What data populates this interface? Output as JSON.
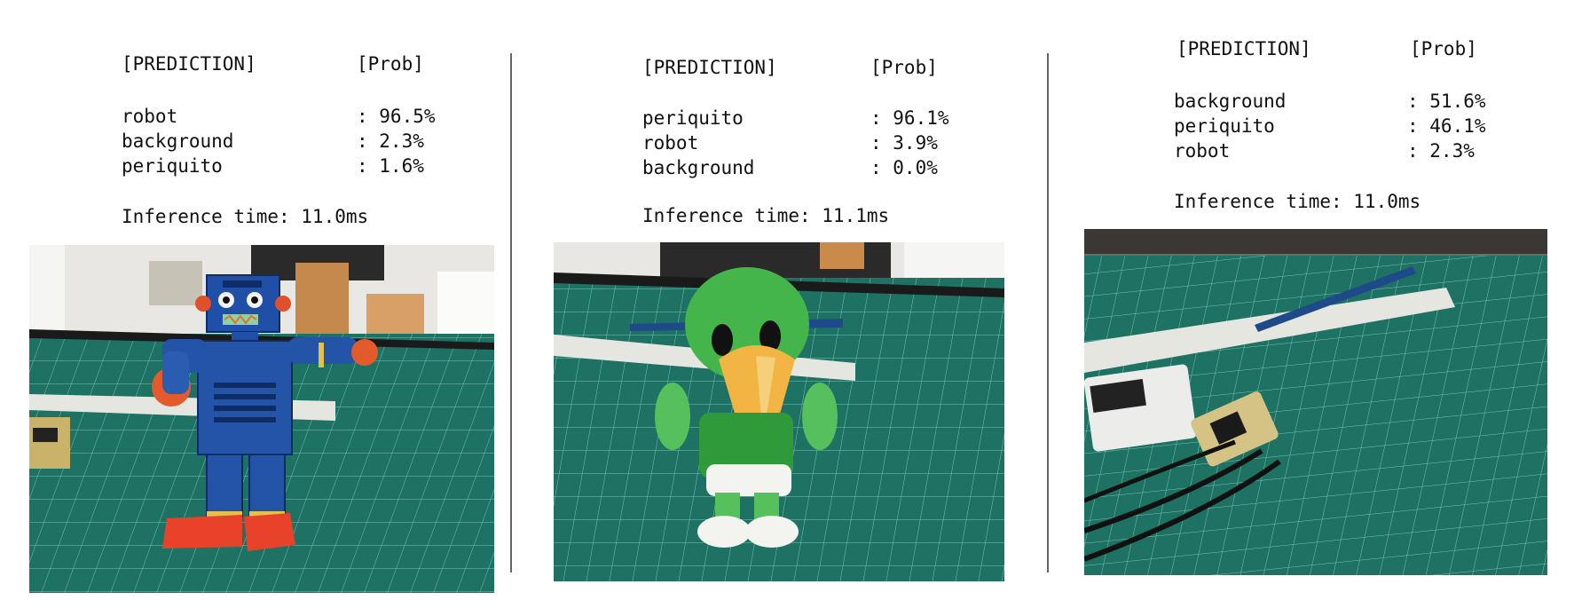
{
  "panels": [
    {
      "header": {
        "prediction": "[PREDICTION]",
        "prob": "[Prob]"
      },
      "rows": [
        {
          "label": "robot",
          "value": ": 96.5%"
        },
        {
          "label": "background",
          "value": ": 2.3%"
        },
        {
          "label": "periquito",
          "value": ": 1.6%"
        }
      ],
      "inference": "Inference time: 11.0ms"
    },
    {
      "header": {
        "prediction": "[PREDICTION]",
        "prob": "[Prob]"
      },
      "rows": [
        {
          "label": "periquito",
          "value": ": 96.1%"
        },
        {
          "label": "robot",
          "value": ": 3.9%"
        },
        {
          "label": "background",
          "value": ": 0.0%"
        }
      ],
      "inference": "Inference time: 11.1ms"
    },
    {
      "header": {
        "prediction": "[PREDICTION]",
        "prob": "[Prob]"
      },
      "rows": [
        {
          "label": "background",
          "value": ": 51.6%"
        },
        {
          "label": "periquito",
          "value": ": 46.1%"
        },
        {
          "label": "robot",
          "value": ": 2.3%"
        }
      ],
      "inference": "Inference time: 11.0ms"
    }
  ]
}
